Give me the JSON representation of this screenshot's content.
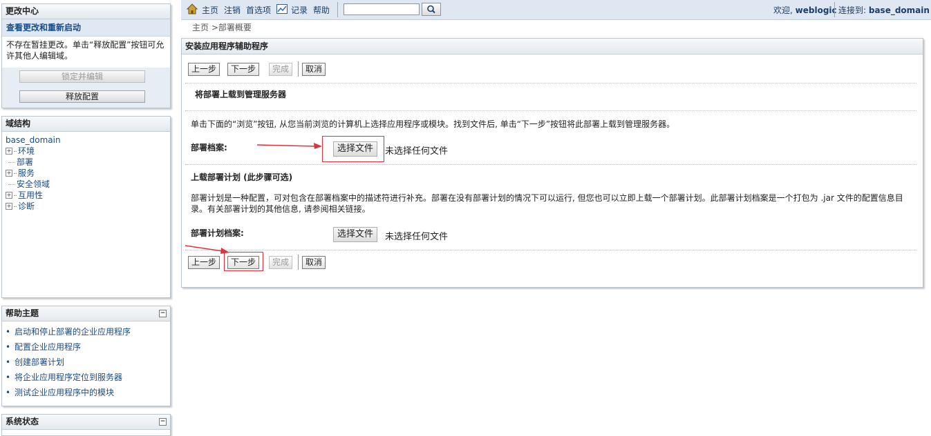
{
  "change_center": {
    "title": "更改中心",
    "link": "查看更改和重新启动",
    "message": "不存在暂挂更改。单击“释放配置”按钮可允许其他人编辑域。",
    "lock_button": "锁定并编辑",
    "release_button": "释放配置"
  },
  "domain_structure": {
    "title": "域结构",
    "root": "base_domain",
    "items": [
      {
        "label": "环境",
        "expandable": true
      },
      {
        "label": "部署",
        "expandable": false
      },
      {
        "label": "服务",
        "expandable": true
      },
      {
        "label": "安全领域",
        "expandable": false
      },
      {
        "label": "互用性",
        "expandable": true
      },
      {
        "label": "诊断",
        "expandable": true
      }
    ]
  },
  "help_topics": {
    "title": "帮助主题",
    "items": [
      "启动和停止部署的企业应用程序",
      "配置企业应用程序",
      "创建部署计划",
      "将企业应用程序定位到服务器",
      "测试企业应用程序中的模块"
    ]
  },
  "system_status": {
    "title": "系统状态"
  },
  "topbar": {
    "home": "主页",
    "logout": "注销",
    "preferences": "首选项",
    "record": "记录",
    "help": "帮助",
    "search_value": "",
    "welcome_prefix": "欢迎, ",
    "user": "weblogic",
    "connected_prefix": "连接到: ",
    "domain": "base_domain"
  },
  "breadcrumb": {
    "home": "主页",
    "sep": " >",
    "current": "部署概要"
  },
  "wizard": {
    "title": "安装应用程序辅助程序",
    "buttons": {
      "back": "上一步",
      "next": "下一步",
      "finish": "完成",
      "cancel": "取消"
    },
    "section1_title": "将部署上载到管理服务器",
    "section1_desc": "单击下面的“浏览”按钮, 从您当前浏览的计算机上选择应用程序或模块。找到文件后, 单击“下一步”按钮将此部署上载到管理服务器。",
    "archive_label": "部署档案:",
    "choose_file": "选择文件",
    "no_file": "未选择任何文件",
    "section2_title": "上载部署计划 (此步骤可选)",
    "section2_desc_line1": "部署计划是一种配置，可对包含在部署档案中的描述符进行补充。部署在没有部署计划的情况下可以运行, 但您也可以立即上载一个部署计划。此部署计划档案是一个打包为 .jar 文件的配置信息目",
    "section2_desc_line2": "录。有关部署计划的其他信息, 请参阅相关链接。",
    "plan_label": "部署计划档案:"
  },
  "colors": {
    "accent": "#1a4b82",
    "annotation": "#e0323a"
  }
}
